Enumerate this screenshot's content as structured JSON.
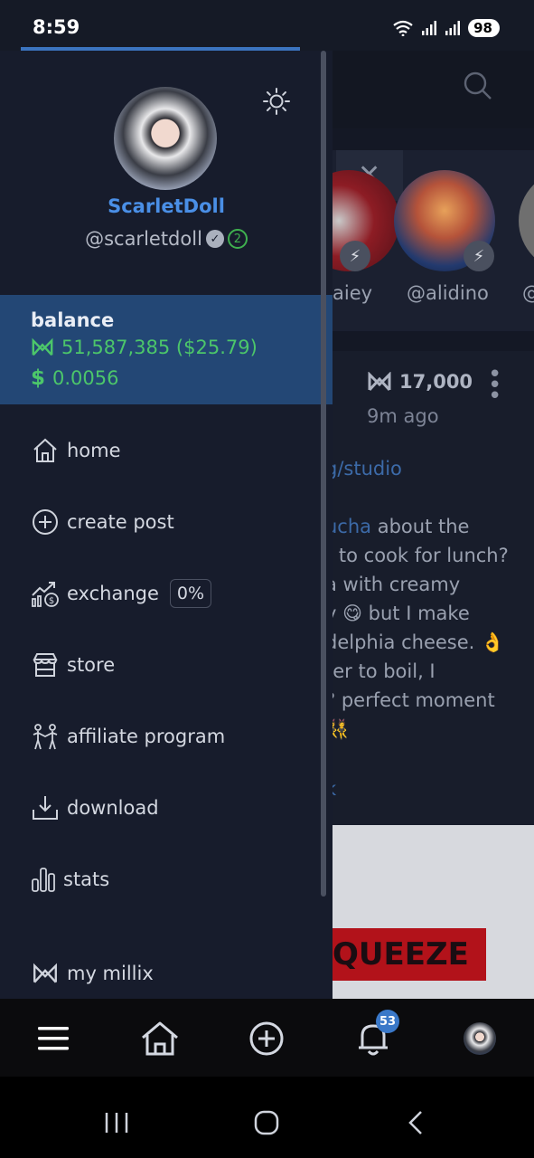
{
  "status_bar": {
    "time": "8:59",
    "battery": "98"
  },
  "background": {
    "stories": [
      "aiey",
      "@alidino",
      "@"
    ],
    "post": {
      "amount": "17,000",
      "time": "9m ago",
      "link": "g/studio",
      "lines": [
        {
          "mention": "ucha",
          "text": " about the"
        },
        {
          "text": "t to cook for lunch?"
        },
        {
          "text": "a with creamy"
        },
        {
          "text": "y 😋 but I make"
        },
        {
          "text": "delphia cheese. 👌"
        },
        {
          "text": "ter to boil, I"
        },
        {
          "text": "? perfect moment"
        },
        {
          "text": "👯"
        }
      ],
      "tail": "k",
      "banner": "QUEEZE"
    }
  },
  "drawer": {
    "display_name": "ScarletDoll",
    "handle": "@scarletdoll",
    "level": "2",
    "balance": {
      "title": "balance",
      "millix": "51,587,385 ($25.79)",
      "usd": "0.0056"
    },
    "menu": [
      {
        "label": "home",
        "icon": "home-icon"
      },
      {
        "label": "create post",
        "icon": "plus-circle-icon"
      },
      {
        "label": "exchange",
        "icon": "exchange-icon",
        "badge": "0%"
      },
      {
        "label": "store",
        "icon": "store-icon"
      },
      {
        "label": "affiliate program",
        "icon": "people-icon"
      },
      {
        "label": "download",
        "icon": "download-icon"
      },
      {
        "label": "stats",
        "icon": "stats-icon"
      },
      {
        "label": "my millix",
        "icon": "millix-icon"
      }
    ]
  },
  "bottom_nav": {
    "notification_count": "53"
  },
  "colors": {
    "accent": "#4a8fe6",
    "positive": "#4cc66a",
    "drawer_bg": "#171c2c",
    "balance_bg": "#234775"
  }
}
